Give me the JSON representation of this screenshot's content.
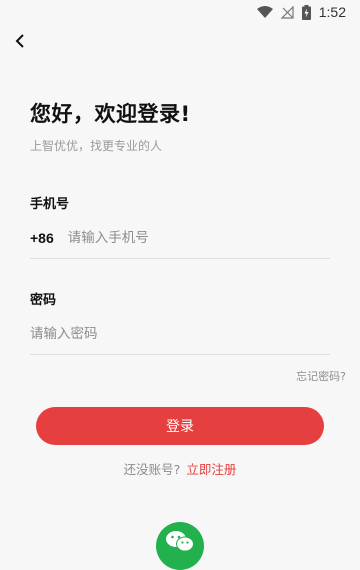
{
  "status_bar": {
    "time": "1:52",
    "icons": [
      "wifi-icon",
      "no-signal-icon",
      "battery-charging-icon"
    ]
  },
  "header": {
    "back_icon": "chevron-left-icon"
  },
  "main": {
    "title": "您好，欢迎登录!",
    "subtitle": "上智优优，找更专业的人"
  },
  "phone": {
    "label": "手机号",
    "prefix": "+86",
    "placeholder": "请输入手机号",
    "value": ""
  },
  "password": {
    "label": "密码",
    "placeholder": "请输入密码",
    "value": ""
  },
  "actions": {
    "forgot": "忘记密码?",
    "login": "登录",
    "no_account": "还没账号?",
    "register": "立即注册"
  },
  "social": {
    "wechat_icon": "wechat-icon"
  },
  "colors": {
    "accent": "#e53f3f",
    "wechat": "#22b14c",
    "background": "#f7f7f7"
  }
}
